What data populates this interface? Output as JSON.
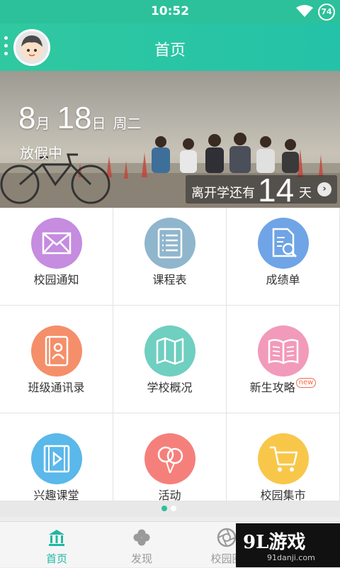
{
  "status_bar": {
    "time": "10:52",
    "battery": "74"
  },
  "header": {
    "title": "首页"
  },
  "banner": {
    "month": "8",
    "month_unit": "月",
    "day": "18",
    "day_unit": "日",
    "weekday": "周二",
    "status": "放假中",
    "countdown_prefix": "离开学还有",
    "countdown_days": "14",
    "countdown_suffix": "天"
  },
  "grid": [
    {
      "label": "校园通知",
      "color": "#c58ce0",
      "icon": "mail-icon"
    },
    {
      "label": "课程表",
      "color": "#8fb6cc",
      "icon": "list-icon"
    },
    {
      "label": "成绩单",
      "color": "#6fa4e6",
      "icon": "report-search-icon"
    },
    {
      "label": "班级通讯录",
      "color": "#f48f6a",
      "icon": "contacts-book-icon"
    },
    {
      "label": "学校概况",
      "color": "#6fcfc0",
      "icon": "map-icon"
    },
    {
      "label": "新生攻略",
      "color": "#f29ab9",
      "icon": "open-book-icon",
      "badge": "new"
    },
    {
      "label": "兴趣课堂",
      "color": "#5ab8ea",
      "icon": "video-icon"
    },
    {
      "label": "活动",
      "color": "#f5807b",
      "icon": "balloons-icon"
    },
    {
      "label": "校园集市",
      "color": "#f8c74a",
      "icon": "cart-icon"
    }
  ],
  "tabs": [
    {
      "label": "首页",
      "icon": "home-building-icon",
      "active": true
    },
    {
      "label": "发现",
      "icon": "clover-icon",
      "active": false
    },
    {
      "label": "校园圈",
      "icon": "aperture-icon",
      "active": false
    }
  ],
  "watermark": {
    "line1": "9L游戏",
    "line2": "91danji.com"
  },
  "colors": {
    "accent": "#2cc19a",
    "tab_active": "#1fb8a3",
    "tab_inactive": "#9a9a9a"
  }
}
